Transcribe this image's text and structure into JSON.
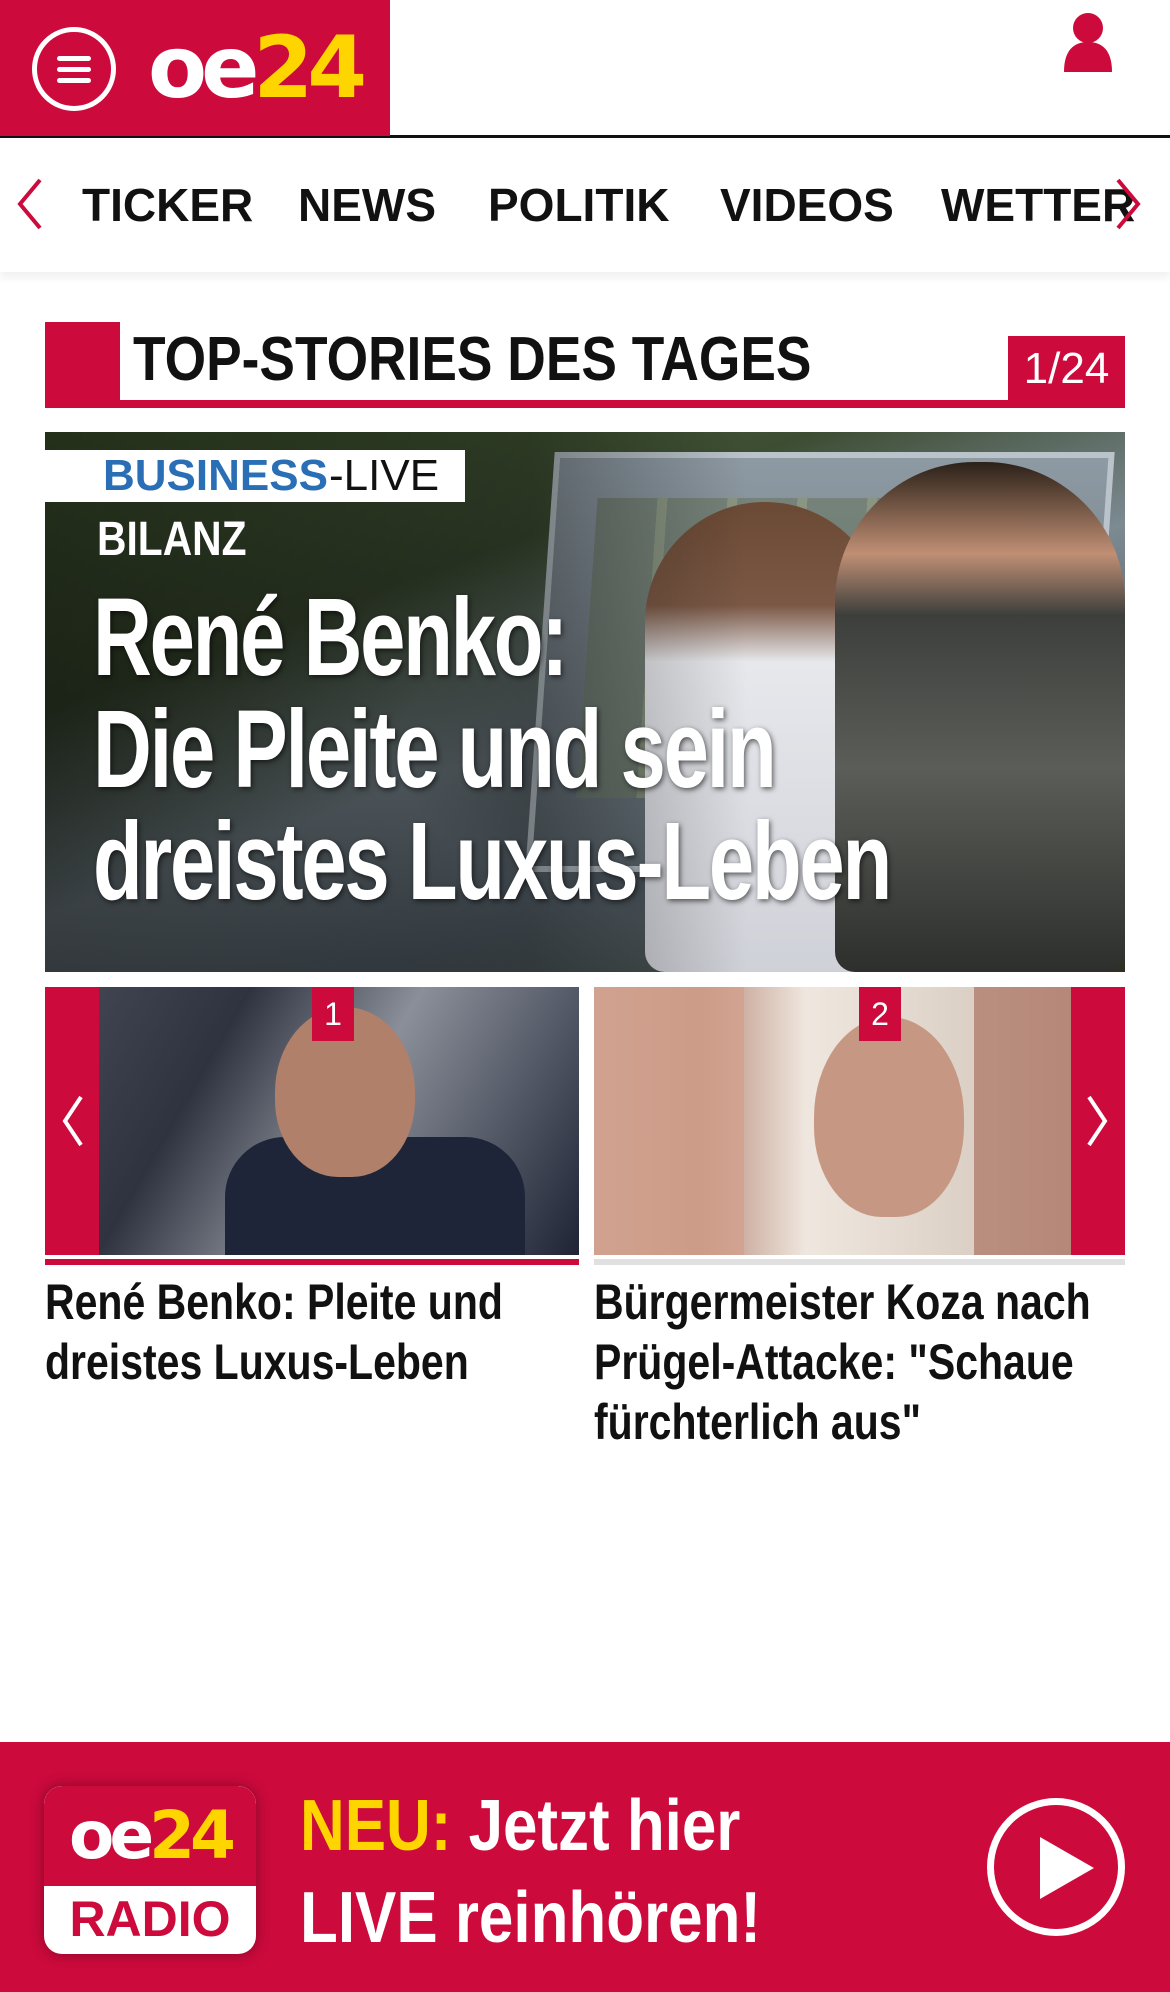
{
  "header": {
    "logo_oe": "oe",
    "logo_num": "24",
    "icons": {
      "menu": "menu-icon",
      "user": "user-icon"
    },
    "colors": {
      "brand": "#cc0a3c",
      "accent": "#ffd500"
    }
  },
  "nav": {
    "items": [
      {
        "label": "TICKER"
      },
      {
        "label": "NEWS"
      },
      {
        "label": "POLITIK"
      },
      {
        "label": "VIDEOS"
      },
      {
        "label": "WETTER"
      }
    ]
  },
  "topstories": {
    "title": "TOP-STORIES DES TAGES",
    "counter": "1/24"
  },
  "hero": {
    "badge_part1": "BUSINESS",
    "badge_part2": "-LIVE",
    "kicker": "BILANZ",
    "headline_lines": [
      "René Benko:",
      "Die Pleite und sein",
      "dreistes Luxus-Leben"
    ]
  },
  "carousel": {
    "cards": [
      {
        "number": "1",
        "title": "René Benko: Pleite und dreistes Luxus-Leben"
      },
      {
        "number": "2",
        "title": "Bürgermeister Koza nach Prügel-Attacke: \"Schaue fürchterlich aus\""
      }
    ]
  },
  "radio": {
    "logo_oe": "oe",
    "logo_num": "24",
    "logo_radio": "RADIO",
    "neu": "NEU:",
    "line1_rest": " Jetzt hier",
    "line2": "LIVE reinhören!"
  }
}
